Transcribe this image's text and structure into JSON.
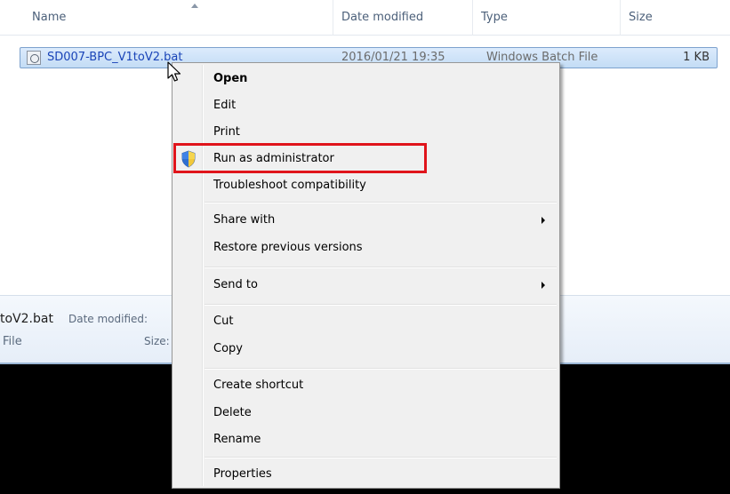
{
  "columns": {
    "name": "Name",
    "date_modified": "Date modified",
    "type": "Type",
    "size": "Size"
  },
  "file": {
    "name": "SD007-BPC_V1toV2.bat",
    "date_modified": "2016/01/21 19:35",
    "type": "Windows Batch File",
    "size": "1 KB",
    "icon": "batch-file-icon"
  },
  "details_pane": {
    "name_fragment": "toV2.bat",
    "date_label": "Date modified:",
    "type_fragment": "File",
    "size_label": "Size:"
  },
  "context_menu": {
    "items": [
      {
        "label": "Open",
        "bold": true
      },
      {
        "label": "Edit"
      },
      {
        "label": "Print"
      },
      {
        "label": "Run as administrator",
        "icon": "uac-shield-icon",
        "highlighted": true
      },
      {
        "label": "Troubleshoot compatibility"
      },
      {
        "label": "Share with",
        "submenu": true
      },
      {
        "label": "Restore previous versions"
      },
      {
        "label": "Send to",
        "submenu": true
      },
      {
        "label": "Cut"
      },
      {
        "label": "Copy"
      },
      {
        "label": "Create shortcut"
      },
      {
        "label": "Delete"
      },
      {
        "label": "Rename"
      },
      {
        "label": "Properties"
      }
    ]
  },
  "colors": {
    "highlight_box": "#e0141b",
    "selection": "#c3dcf5",
    "file_name": "#1a44b8"
  }
}
